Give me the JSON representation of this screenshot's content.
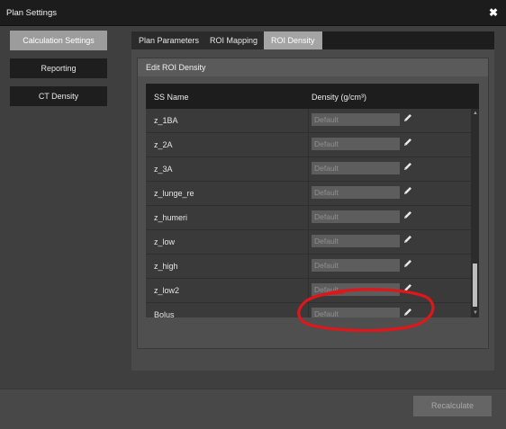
{
  "window": {
    "title": "Plan Settings",
    "close_label": "✖"
  },
  "nav": {
    "calculation_settings": "Calculation Settings",
    "reporting": "Reporting",
    "ct_density": "CT Density"
  },
  "tabs": {
    "plan_parameters": "Plan Parameters",
    "roi_mapping": "ROI Mapping",
    "roi_density": "ROI Density"
  },
  "group": {
    "title": "Edit ROI Density"
  },
  "table": {
    "col_name": "SS Name",
    "col_density": "Density (g/cm³)",
    "rows": [
      {
        "name": "z_1BA",
        "density_placeholder": "Default"
      },
      {
        "name": "z_2A",
        "density_placeholder": "Default"
      },
      {
        "name": "z_3A",
        "density_placeholder": "Default"
      },
      {
        "name": "z_lunge_re",
        "density_placeholder": "Default"
      },
      {
        "name": "z_humeri",
        "density_placeholder": "Default"
      },
      {
        "name": "z_low",
        "density_placeholder": "Default"
      },
      {
        "name": "z_high",
        "density_placeholder": "Default"
      },
      {
        "name": "z_low2",
        "density_placeholder": "Default"
      },
      {
        "name": "Bolus",
        "density_placeholder": "Default"
      }
    ]
  },
  "footer": {
    "recalculate": "Recalculate"
  },
  "colors": {
    "titlebar": "#1c1c1c",
    "active_nav": "#9c9c9c",
    "active_tab": "#a4a4a4",
    "annotation": "#e0161b"
  }
}
